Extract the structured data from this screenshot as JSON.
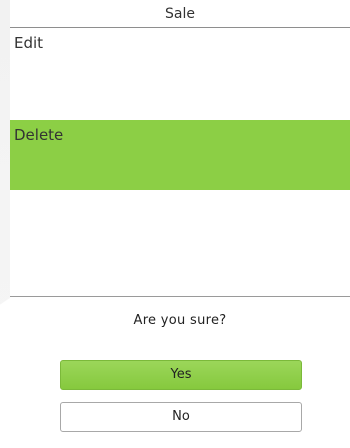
{
  "window": {
    "title": "Sale"
  },
  "menu": {
    "items": [
      {
        "label": "Edit"
      },
      {
        "label": "Delete",
        "selected": true
      }
    ]
  },
  "dialog": {
    "message": "Are you sure?",
    "yes_label": "Yes",
    "no_label": "No"
  },
  "colors": {
    "accent": "#8ccf45",
    "border": "#9a9a9a",
    "text": "#333333"
  }
}
